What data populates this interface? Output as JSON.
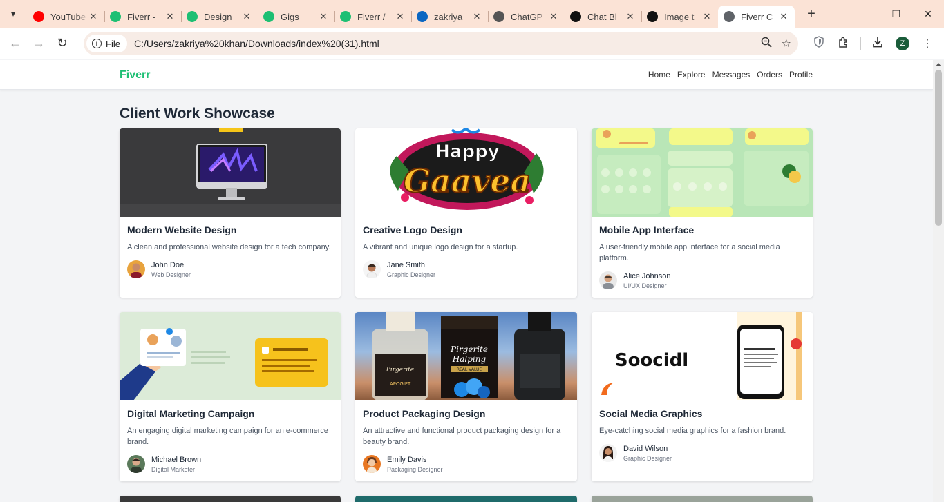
{
  "browser": {
    "tabs": [
      {
        "label": "YouTube",
        "icon": "youtube-icon",
        "color": "#ff0000"
      },
      {
        "label": "Fiverr -",
        "icon": "fiverr-icon",
        "color": "#1dbf73"
      },
      {
        "label": "Design",
        "icon": "fiverr-icon",
        "color": "#1dbf73"
      },
      {
        "label": "Gigs",
        "icon": "fiverr-icon",
        "color": "#1dbf73"
      },
      {
        "label": "Fiverr /",
        "icon": "fiverr-icon",
        "color": "#1dbf73"
      },
      {
        "label": "zakriya",
        "icon": "linkedin-icon",
        "color": "#0a66c2"
      },
      {
        "label": "ChatGP",
        "icon": "chatgpt-icon",
        "color": "#555555"
      },
      {
        "label": "Chat Bl",
        "icon": "blackbox-icon",
        "color": "#111111"
      },
      {
        "label": "Image t",
        "icon": "blackbox-icon",
        "color": "#111111"
      },
      {
        "label": "Fiverr C",
        "icon": "globe-icon",
        "color": "#5f6368"
      }
    ],
    "address": {
      "chip": "File",
      "url": "C:/Users/zakriya%20khan/Downloads/index%20(31).html"
    },
    "profile_initial": "Z"
  },
  "site": {
    "brand": "Fiverr",
    "brand_color": "#1dbf73",
    "nav": [
      "Home",
      "Explore",
      "Messages",
      "Orders",
      "Profile"
    ],
    "page_title": "Client Work Showcase"
  },
  "cards": [
    {
      "title": "Modern Website Design",
      "desc": "A clean and professional website design for a tech company.",
      "author": "John Doe",
      "role": "Web Designer"
    },
    {
      "title": "Creative Logo Design",
      "desc": "A vibrant and unique logo design for a startup.",
      "author": "Jane Smith",
      "role": "Graphic Designer",
      "image_text": [
        "Happy",
        "Gaavea"
      ]
    },
    {
      "title": "Mobile App Interface",
      "desc": "A user-friendly mobile app interface for a social media platform.",
      "author": "Alice Johnson",
      "role": "UI/UX Designer"
    },
    {
      "title": "Digital Marketing Campaign",
      "desc": "An engaging digital marketing campaign for an e-commerce brand.",
      "author": "Michael Brown",
      "role": "Digital Marketer"
    },
    {
      "title": "Product Packaging Design",
      "desc": "An attractive and functional product packaging design for a beauty brand.",
      "author": "Emily Davis",
      "role": "Packaging Designer",
      "image_text": [
        "Pirgerite",
        "Halping",
        "REAL VALUE",
        "APOGIFT"
      ]
    },
    {
      "title": "Social Media Graphics",
      "desc": "Eye-catching social media graphics for a fashion brand.",
      "author": "David Wilson",
      "role": "Graphic Designer",
      "image_text": [
        "Soocidl"
      ]
    }
  ]
}
